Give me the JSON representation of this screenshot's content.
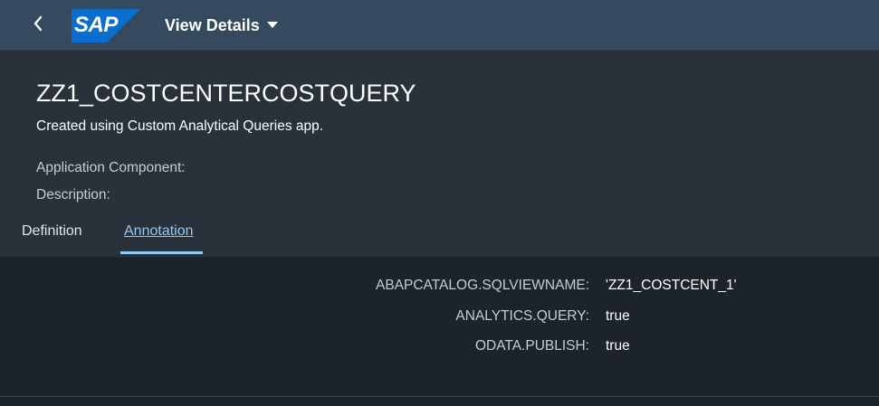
{
  "shell": {
    "logo_text": "SAP",
    "title": "View Details",
    "colors": {
      "shell_bg": "#354a5f",
      "logo_blue": "#0a6ed1",
      "accent": "#91c8f6"
    }
  },
  "object": {
    "title": "ZZ1_COSTCENTERCOSTQUERY",
    "subtitle": "Created using Custom Analytical Queries app.",
    "attributes": [
      {
        "label": "Application Component:"
      },
      {
        "label": "Description:"
      }
    ]
  },
  "tabs": [
    {
      "label": "Definition",
      "selected": false
    },
    {
      "label": "Annotation",
      "selected": true
    }
  ],
  "annotations": [
    {
      "key": "ABAPCATALOG.SQLVIEWNAME:",
      "value": "'ZZ1_COSTCENT_1'"
    },
    {
      "key": "ANALYTICS.QUERY:",
      "value": "true"
    },
    {
      "key": "ODATA.PUBLISH:",
      "value": "true"
    }
  ]
}
